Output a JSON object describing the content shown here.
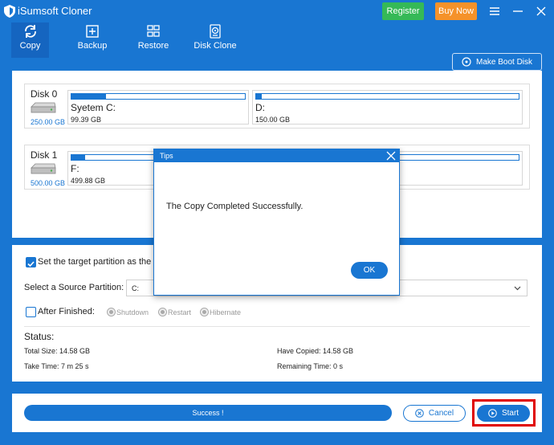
{
  "app": {
    "title": "iSumsoft Cloner",
    "register_label": "Register",
    "buy_label": "Buy Now"
  },
  "toolbar": {
    "tabs": [
      {
        "label": "Copy",
        "icon": "refresh-icon",
        "active": true
      },
      {
        "label": "Backup",
        "icon": "backup-icon",
        "active": false
      },
      {
        "label": "Restore",
        "icon": "restore-icon",
        "active": false
      },
      {
        "label": "Disk Clone",
        "icon": "disk-clone-icon",
        "active": false
      }
    ],
    "boot_label": "Make Boot Disk"
  },
  "disks": [
    {
      "name": "Disk 0",
      "size": "250.00 GB",
      "partitions": [
        {
          "label": "Syetem C:",
          "size": "99.39 GB",
          "used_fraction": 0.2
        },
        {
          "label": "D:",
          "size": "150.00 GB",
          "used_fraction": 0.02
        }
      ]
    },
    {
      "name": "Disk 1",
      "size": "500.00 GB",
      "partitions": [
        {
          "label": "F:",
          "size": "499.88 GB",
          "used_fraction": 0.03
        }
      ]
    }
  ],
  "options": {
    "target_label": "Set the target partition as the b",
    "target_checked": true,
    "source_label": "Select a Source Partition:",
    "source_value": "C:",
    "after_label": "After Finished:",
    "after_checked": false,
    "radios": [
      "Shutdown",
      "Restart",
      "Hibernate"
    ]
  },
  "status": {
    "heading": "Status:",
    "total_size": "Total Size: 14.58 GB",
    "have_copied": "Have Copied: 14.58 GB",
    "take_time": "Take Time: 7 m 25 s",
    "remaining_time": "Remaining Time: 0 s"
  },
  "bottom": {
    "progress_text": "Success !",
    "progress_fraction": 1.0,
    "cancel_label": "Cancel",
    "start_label": "Start"
  },
  "dialog": {
    "title": "Tips",
    "message": "The Copy Completed Successfully.",
    "ok_label": "OK"
  },
  "colors": {
    "primary": "#1976d2",
    "register": "#35b957",
    "buy": "#f5922a",
    "highlight": "#e00000"
  }
}
